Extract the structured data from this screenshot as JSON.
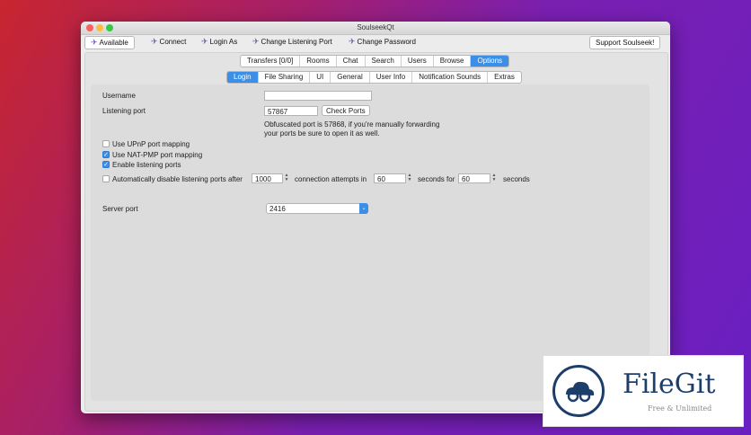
{
  "window": {
    "title": "SoulseekQt"
  },
  "toolbar": {
    "available": "Available",
    "connect": "Connect",
    "login_as": "Login As",
    "change_port": "Change Listening Port",
    "change_password": "Change Password",
    "support": "Support Soulseek!"
  },
  "main_tabs": [
    "Transfers [0/0]",
    "Rooms",
    "Chat",
    "Search",
    "Users",
    "Browse",
    "Options"
  ],
  "sub_tabs": [
    "Login",
    "File Sharing",
    "UI",
    "General",
    "User Info",
    "Notification Sounds",
    "Extras"
  ],
  "login": {
    "username_label": "Username",
    "username_value": "",
    "listening_port_label": "Listening port",
    "listening_port_value": "57867",
    "check_ports": "Check Ports",
    "obfuscated_line1": "Obfuscated port is 57868, if you're manually forwarding",
    "obfuscated_line2": "your ports be sure to open it as well.",
    "upnp_label": "Use UPnP port mapping",
    "natpmp_label": "Use NAT-PMP port mapping",
    "enable_label": "Enable listening ports",
    "auto_disable_label": "Automatically disable listening ports after",
    "auto_disable_value": "1000",
    "attempts_label": "connection attempts in",
    "attempts_value": "60",
    "seconds_for_label": "seconds for",
    "seconds_for_value": "60",
    "seconds_label": "seconds",
    "server_port_label": "Server port",
    "server_port_value": "2416"
  },
  "watermark": {
    "brand": "FileGit",
    "tagline": "Free & Unlimited"
  }
}
